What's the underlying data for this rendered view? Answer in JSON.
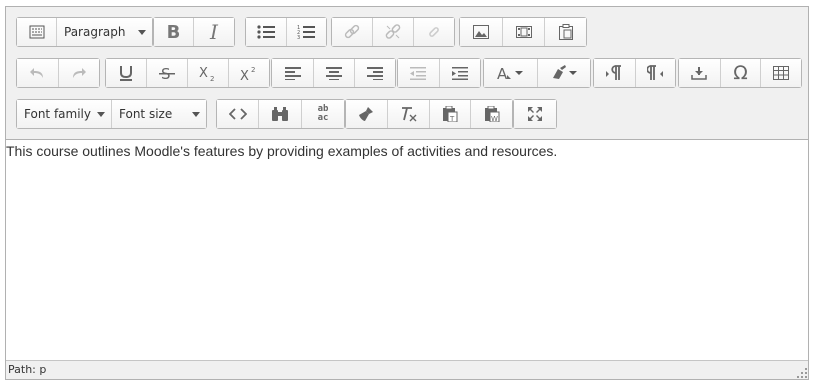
{
  "toolbar": {
    "block_format": {
      "selected": "Paragraph"
    },
    "font_family": {
      "selected": "Font family"
    },
    "font_size": {
      "selected": "Font size"
    },
    "icons": [
      "toolbar-toggle-icon",
      "bold-icon",
      "italic-icon",
      "bullet-list-icon",
      "numbered-list-icon",
      "link-icon",
      "unlink-icon",
      "anchor-icon",
      "image-icon",
      "media-icon",
      "paste-icon",
      "undo-icon",
      "redo-icon",
      "underline-icon",
      "strikethrough-icon",
      "subscript-icon",
      "superscript-icon",
      "align-left-icon",
      "align-center-icon",
      "align-right-icon",
      "outdent-icon",
      "indent-icon",
      "text-color-icon",
      "background-color-icon",
      "ltr-icon",
      "rtl-icon",
      "insert-icon",
      "omega-icon",
      "table-icon",
      "code-icon",
      "search-replace-icon",
      "spellcheck-icon",
      "brush-icon",
      "clear-formatting-icon",
      "paste-text-icon",
      "paste-word-icon",
      "fullscreen-icon"
    ],
    "bold_glyph": "B",
    "italic_glyph": "I",
    "omega_glyph": "Ω",
    "spell_glyph_top": "ab",
    "spell_glyph_bottom": "ac"
  },
  "content": {
    "text": "This course outlines Moodle's features by providing examples of activities and resources."
  },
  "statusbar": {
    "path": "Path: p"
  },
  "colors": {
    "toolbar_bg": "#f0f0f0",
    "border": "#b1b1b1",
    "icon": "#555555",
    "icon_disabled": "#bbbbbb"
  }
}
